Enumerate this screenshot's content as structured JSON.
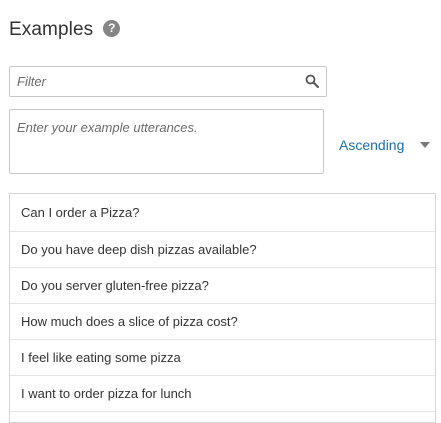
{
  "header": {
    "title": "Examples",
    "help_icon": "?"
  },
  "filter": {
    "placeholder": "Filter",
    "value": ""
  },
  "utterance": {
    "placeholder": "Enter your example utterances.",
    "value": ""
  },
  "sort": {
    "selected": "Ascending"
  },
  "examples": [
    "Can I order a Pizza?",
    "Do you have deep dish pizzas available?",
    "Do you server gluten-free pizza?",
    "How much does a slice of pizza cost?",
    "I feel like eating some pizza",
    "I want to order pizza for lunch"
  ],
  "colors": {
    "link": "#1a6fa8",
    "help_icon_bg": "#858585"
  }
}
